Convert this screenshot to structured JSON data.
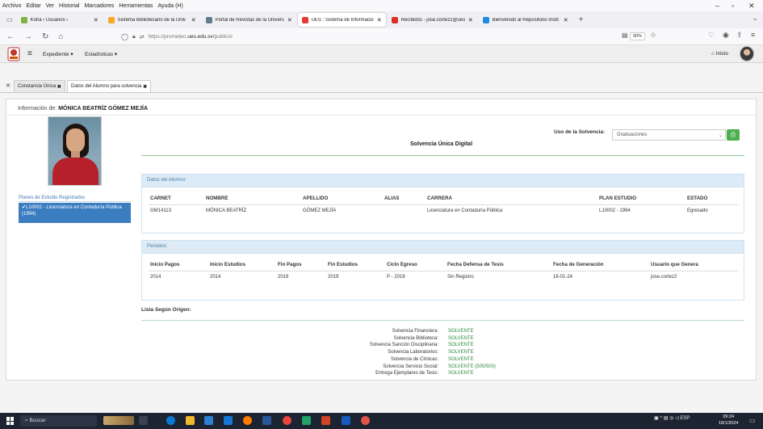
{
  "browser": {
    "menu": [
      "Archivo",
      "Editar",
      "Ver",
      "Historial",
      "Marcadores",
      "Herramientas",
      "Ayuda (H)"
    ],
    "tabs": [
      {
        "title": "Koha › Usuarios ›",
        "color": "#7cb342",
        "active": false
      },
      {
        "title": "Sistema Bibliotecario de la Univ",
        "color": "#f9a825",
        "active": false
      },
      {
        "title": "Portal de Revistas de la Univers",
        "color": "#607d8b",
        "active": false
      },
      {
        "title": "UES : Sistema de Información",
        "color": "#e53935",
        "active": true
      },
      {
        "title": "Recibidos - jose.cortez2@ues.e",
        "color": "#d93025",
        "active": false
      },
      {
        "title": "Bienvenido al Repositorio Instit",
        "color": "#1e88e5",
        "active": false
      }
    ],
    "url_prefix": "https://prometeo.",
    "url_domain": "ues.edu.sv",
    "url_path": "/public/#",
    "zoom": "90%"
  },
  "app": {
    "menu_expediente": "Expediente",
    "menu_estadisticas": "Estadísticas",
    "inicio": "Inicio"
  },
  "app_tabs": [
    {
      "label": "Constancia Única"
    },
    {
      "label": "Datos del Alumno para solvencia"
    }
  ],
  "info": {
    "label": "Información de:",
    "name": "MÓNICA BEATRÍZ GÓMEZ MEJÍA"
  },
  "planes": {
    "label": "Planes de Estudio Registrados",
    "item": "L10002 - Licenciatura en Contaduría Pública (1994)"
  },
  "uso": {
    "label": "Uso de la Solvencia:",
    "value": "Graduaciones"
  },
  "title": "Solvencia Única Digital",
  "alumno": {
    "heading": "Datos del Alumno:",
    "columns": [
      "CARNET",
      "NOMBRE",
      "APELLIDO",
      "ALIAS",
      "CARRERA",
      "PLAN ESTUDIO",
      "ESTADO"
    ],
    "row": [
      "GM14113",
      "MÓNICA BEATRÍZ",
      "GÓMEZ MEJÍA",
      "",
      "Licenciatura en Contaduría Pública",
      "L10002 - 1994",
      "Egresado"
    ]
  },
  "periodos": {
    "heading": "Periodos:",
    "columns": [
      "Inicio Pagos",
      "Inicio Estudios",
      "Fin Pagos",
      "Fin Estudios",
      "Ciclo Egreso",
      "Fecha Defensa de Tesis",
      "Fecha de Generación",
      "Usuario que Genera"
    ],
    "row": [
      "2014",
      "2014",
      "2019",
      "2019",
      "P - 2018",
      "Sin Registro",
      "18-01-24",
      "jose.cortez2"
    ]
  },
  "lista": {
    "heading": "Lista Según Origen:",
    "items": [
      {
        "label": "Solvencia Financiera:",
        "value": "SOLVENTE"
      },
      {
        "label": "Solvencia Biblioteca:",
        "value": "SOLVENTE"
      },
      {
        "label": "Solvencia Sanción Disciplinaria:",
        "value": "SOLVENTE"
      },
      {
        "label": "Solvencia Laboratorios:",
        "value": "SOLVENTE"
      },
      {
        "label": "Solvencia de Clínicas:",
        "value": "SOLVENTE"
      },
      {
        "label": "Solvencia Servicio Social:",
        "value": "SOLVENTE (500/500)"
      },
      {
        "label": "Entrega Ejemplares de Tesis:",
        "value": "SOLVENTE"
      }
    ]
  },
  "taskbar": {
    "search": "Buscar",
    "lang": "ESP",
    "time": "09:24",
    "date": "18/1/2024"
  }
}
